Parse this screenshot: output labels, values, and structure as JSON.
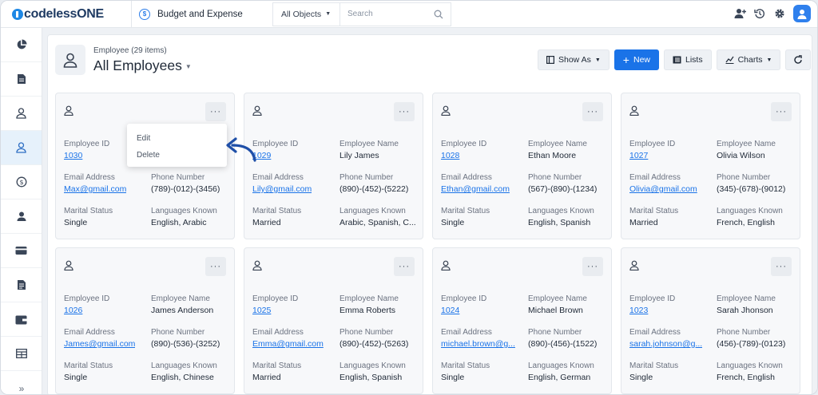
{
  "brand": {
    "name_a": "codeless",
    "name_b": "ONE"
  },
  "app": {
    "title": "Budget and Expense",
    "icon": "dollar-icon"
  },
  "objects": {
    "label": "All Objects"
  },
  "search": {
    "placeholder": "Search"
  },
  "topbar_icons": [
    "add-user-icon",
    "history-icon",
    "gear-icon",
    "user-avatar"
  ],
  "sidebar": {
    "items": [
      "pie-chart-icon",
      "document-icon",
      "user-icon",
      "user-icon",
      "dollar-icon",
      "person-card-icon",
      "credit-card-icon",
      "document-icon",
      "wallet-icon",
      "table-icon"
    ],
    "active_index": 3
  },
  "page": {
    "subtitle": "Employee (29 items)",
    "title": "All Employees"
  },
  "actions": {
    "show_as": "Show As",
    "new": "New",
    "lists": "Lists",
    "charts": "Charts"
  },
  "context_menu": {
    "items": [
      "Edit",
      "Delete"
    ]
  },
  "labels": {
    "id": "Employee ID",
    "name": "Employee Name",
    "email": "Email Address",
    "phone": "Phone Number",
    "marital": "Marital Status",
    "languages": "Languages Known"
  },
  "employees": [
    {
      "id": "1030",
      "name": "",
      "email": "Max@gmail.com",
      "phone": "(789)-(012)-(3456)",
      "marital": "Single",
      "languages": "English, Arabic"
    },
    {
      "id": "1029",
      "name": "Lily James",
      "email": "Lily@gmail.com",
      "phone": "(890)-(452)-(5222)",
      "marital": "Married",
      "languages": "Arabic, Spanish, C..."
    },
    {
      "id": "1028",
      "name": "Ethan Moore",
      "email": "Ethan@gmail.com",
      "phone": "(567)-(890)-(1234)",
      "marital": "Single",
      "languages": "English, Spanish"
    },
    {
      "id": "1027",
      "name": "Olivia Wilson",
      "email": "Olivia@gmail.com",
      "phone": "(345)-(678)-(9012)",
      "marital": "Married",
      "languages": "French, English"
    },
    {
      "id": "1026",
      "name": "James Anderson",
      "email": "James@gmail.com",
      "phone": "(890)-(536)-(3252)",
      "marital": "Single",
      "languages": "English, Chinese"
    },
    {
      "id": "1025",
      "name": "Emma Roberts",
      "email": "Emma@gmail.com",
      "phone": "(890)-(452)-(5263)",
      "marital": "Married",
      "languages": "English, Spanish"
    },
    {
      "id": "1024",
      "name": "Michael Brown",
      "email": "michael.brown@g...",
      "phone": "(890)-(456)-(1522)",
      "marital": "Single",
      "languages": "English, German"
    },
    {
      "id": "1023",
      "name": "Sarah Jhonson",
      "email": "sarah.johnson@g...",
      "phone": "(456)-(789)-(0123)",
      "marital": "Single",
      "languages": "French, English"
    }
  ],
  "colors": {
    "accent": "#1a73e8",
    "brand": "#1f3b63",
    "active_sidebar": "#e6f1fb",
    "arrow": "#1f4fa8"
  }
}
